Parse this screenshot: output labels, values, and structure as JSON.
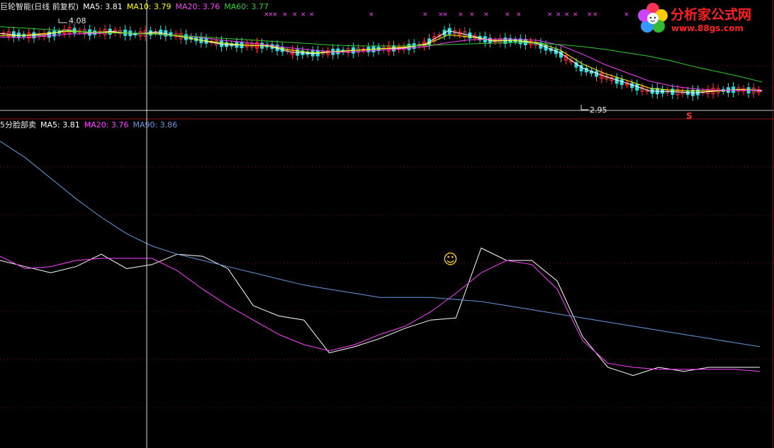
{
  "top_panel": {
    "title": "巨轮智能(日线 前复权)",
    "ma5_label": "MA5: 3.81",
    "ma10_label": "MA10: 3.79",
    "ma20_label": "MA20: 3.76",
    "ma60_label": "MA60: 3.77",
    "high_label": "4.08",
    "low_label": "2.95",
    "sell_marker": "S",
    "signal_marker": "×"
  },
  "bottom_panel": {
    "title": "5分脸部卖",
    "ma5_label": "MA5: 3.81",
    "ma20_label": "MA20: 3.76",
    "ma90_label": "MA90: 3.86",
    "smiley": "☺"
  },
  "logo": {
    "text": "分析家公式网",
    "url": "www.88gs.com"
  },
  "colors": {
    "bg": "#000000",
    "title": "#e8e8e8",
    "ma5": "#ffffff",
    "ma10": "#ffff00",
    "ma20": "#ff40ff",
    "ma60": "#33cc33",
    "ma90": "#6699dd",
    "up": "#ff3030",
    "down": "#33dddd",
    "grid": "#7a1010",
    "marker": "#ff40ff"
  },
  "chart_data": [
    {
      "type": "line",
      "title": "巨轮智能(日线 前复权)",
      "note_high": 4.08,
      "note_low": 2.95,
      "series": [
        {
          "name": "MA5",
          "values": [
            3.9,
            3.87,
            3.88,
            3.95,
            3.91,
            3.93,
            3.89,
            3.92,
            3.86,
            3.8,
            3.74,
            3.73,
            3.72,
            3.63,
            3.61,
            3.64,
            3.66,
            3.68,
            3.69,
            3.75,
            3.94,
            3.87,
            3.79,
            3.8,
            3.75,
            3.62,
            3.4,
            3.28,
            3.18,
            3.07,
            3.06,
            3.04,
            3.07,
            3.09,
            3.07
          ]
        },
        {
          "name": "MA10",
          "values": [
            3.87,
            3.87,
            3.9,
            3.93,
            3.92,
            3.92,
            3.9,
            3.9,
            3.86,
            3.8,
            3.76,
            3.73,
            3.72,
            3.66,
            3.62,
            3.64,
            3.66,
            3.68,
            3.7,
            3.74,
            3.88,
            3.85,
            3.8,
            3.8,
            3.77,
            3.66,
            3.46,
            3.32,
            3.22,
            3.11,
            3.08,
            3.07,
            3.07,
            3.09,
            3.08
          ]
        },
        {
          "name": "MA20",
          "values": [
            3.85,
            3.84,
            3.86,
            3.89,
            3.9,
            3.91,
            3.9,
            3.89,
            3.87,
            3.84,
            3.8,
            3.77,
            3.73,
            3.69,
            3.66,
            3.63,
            3.64,
            3.66,
            3.68,
            3.71,
            3.77,
            3.81,
            3.82,
            3.82,
            3.8,
            3.73,
            3.6,
            3.45,
            3.33,
            3.21,
            3.14,
            3.1,
            3.08,
            3.08,
            3.08
          ]
        },
        {
          "name": "MA60",
          "values": [
            4.0,
            3.98,
            3.96,
            3.94,
            3.92,
            3.91,
            3.9,
            3.89,
            3.87,
            3.85,
            3.83,
            3.81,
            3.79,
            3.77,
            3.75,
            3.73,
            3.72,
            3.72,
            3.72,
            3.73,
            3.74,
            3.75,
            3.76,
            3.77,
            3.76,
            3.74,
            3.71,
            3.67,
            3.62,
            3.57,
            3.5,
            3.42,
            3.35,
            3.28,
            3.2
          ]
        }
      ]
    },
    {
      "type": "line",
      "title": "5分脸部卖",
      "series": [
        {
          "name": "MA5",
          "values": [
            3.82,
            3.79,
            3.76,
            3.79,
            3.85,
            3.78,
            3.8,
            3.85,
            3.84,
            3.78,
            3.6,
            3.55,
            3.53,
            3.37,
            3.4,
            3.44,
            3.49,
            3.53,
            3.54,
            3.88,
            3.82,
            3.82,
            3.72,
            3.45,
            3.3,
            3.26,
            3.3,
            3.28,
            3.3,
            3.3,
            3.3
          ]
        },
        {
          "name": "MA20",
          "values": [
            3.84,
            3.78,
            3.79,
            3.82,
            3.83,
            3.83,
            3.83,
            3.77,
            3.68,
            3.6,
            3.53,
            3.46,
            3.41,
            3.38,
            3.41,
            3.46,
            3.5,
            3.57,
            3.66,
            3.76,
            3.82,
            3.8,
            3.68,
            3.43,
            3.32,
            3.3,
            3.29,
            3.29,
            3.29,
            3.29,
            3.28
          ]
        },
        {
          "name": "MA90",
          "values": [
            4.4,
            4.32,
            4.22,
            4.12,
            4.03,
            3.95,
            3.89,
            3.85,
            3.82,
            3.79,
            3.76,
            3.73,
            3.7,
            3.68,
            3.66,
            3.64,
            3.64,
            3.64,
            3.63,
            3.62,
            3.6,
            3.58,
            3.56,
            3.54,
            3.52,
            3.5,
            3.48,
            3.46,
            3.44,
            3.42,
            3.4
          ]
        }
      ]
    }
  ]
}
